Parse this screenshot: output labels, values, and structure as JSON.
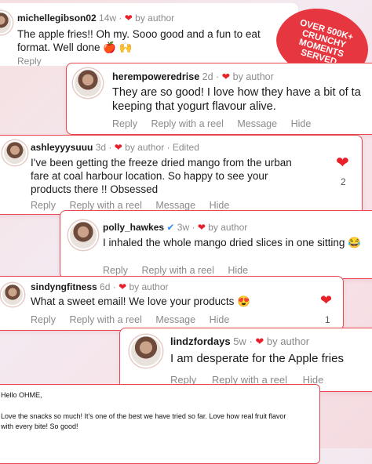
{
  "badge": {
    "line1": "OVER 500K+",
    "line2": "CRUNCHY",
    "line3": "MOMENTS",
    "line4": "SERVED"
  },
  "c1": {
    "user": "michellegibson02",
    "time": "14w",
    "by": "by author",
    "text": "The apple fries!! Oh my. Sooo good and a fun to eat format. Well done",
    "emoji": "🍎 🙌",
    "reply": "Reply"
  },
  "c2": {
    "user": "herempoweredrise",
    "time": "2d",
    "by": "by author",
    "text": "They are so good! I love how they have a bit of ta keeping that yogurt flavour alive.",
    "actions": [
      "Reply",
      "Reply with a reel",
      "Message",
      "Hide"
    ]
  },
  "c3": {
    "user": "ashleyyysuuu",
    "time": "3d",
    "by": "by author",
    "edited": "· Edited",
    "text": "I've been getting the freeze dried mango from the urban fare at coal harbour location. So happy to see your products there !! Obsessed",
    "actions": [
      "Reply",
      "Reply with a reel",
      "Message",
      "Hide"
    ],
    "likes": "2"
  },
  "c4": {
    "user": "polly_hawkes",
    "time": "3w",
    "by": "by author",
    "text": "I inhaled the whole mango dried slices in one sitting",
    "emoji": "😂",
    "actions": [
      "Reply",
      "Reply with a reel",
      "Hide"
    ]
  },
  "c5": {
    "user": "sindyngfitness",
    "time": "6d",
    "by": "by author",
    "text": "What a sweet email! We love your products",
    "emoji": "😍",
    "actions": [
      "Reply",
      "Reply with a reel",
      "Message",
      "Hide"
    ],
    "likes": "1"
  },
  "c6": {
    "user": "lindzfordays",
    "time": "5w",
    "by": "by author",
    "text": "I am desperate for the Apple fries",
    "actions": [
      "Reply",
      "Reply with a reel",
      "Hide"
    ]
  },
  "email": {
    "greeting": "Hello OHME,",
    "body": "Love the snacks so much! It's one of the best we have tried so far. Love how real fruit flavor with every bite! So good!"
  },
  "colors": {
    "accent": "#e8474f",
    "heart": "#e8202a",
    "badge": "#e63740"
  },
  "icons": [
    "heart-icon",
    "verified-icon"
  ]
}
